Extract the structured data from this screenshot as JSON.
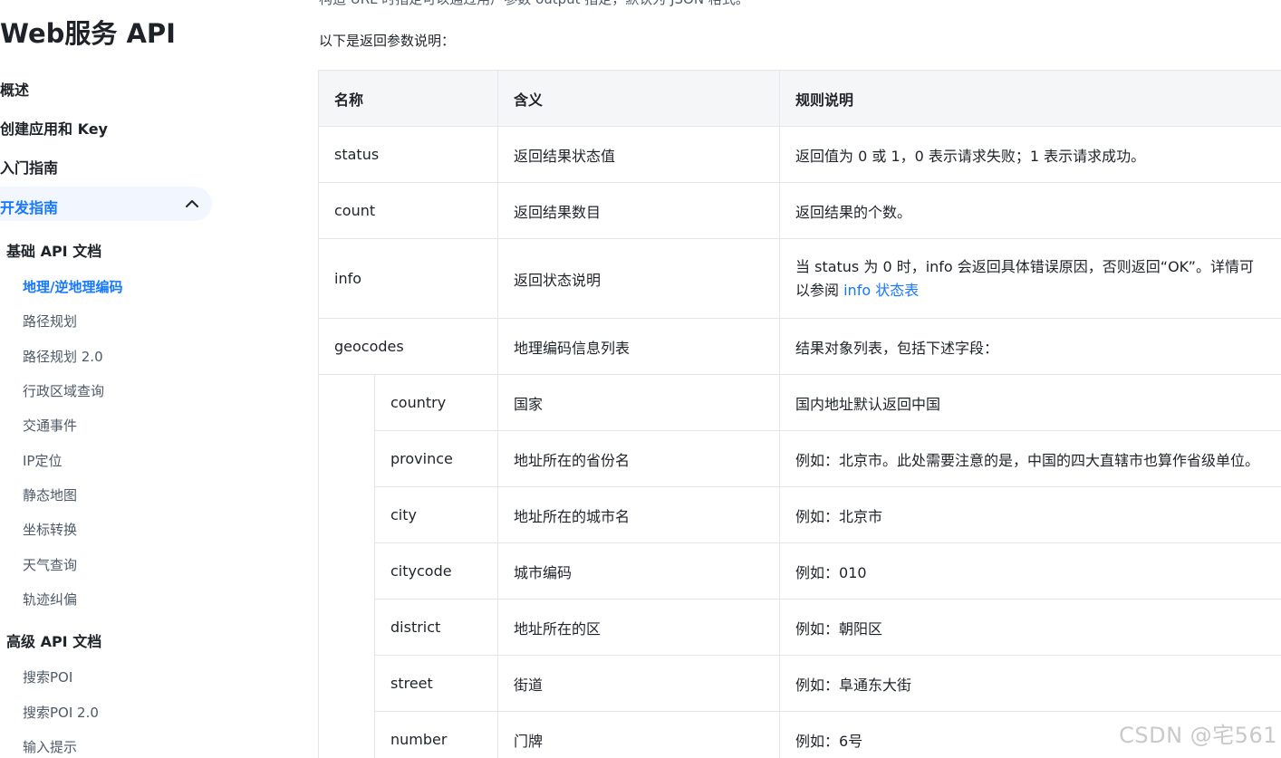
{
  "sidebar": {
    "title": "Web服务 API",
    "top_items": [
      {
        "label": "概述"
      },
      {
        "label": "创建应用和 Key"
      },
      {
        "label": "入门指南"
      }
    ],
    "active_section": "开发指南",
    "groups": [
      {
        "title": "基础 API 文档",
        "items": [
          "地理/逆地理编码",
          "路径规划",
          "路径规划 2.0",
          "行政区域查询",
          "交通事件",
          "IP定位",
          "静态地图",
          "坐标转换",
          "天气查询",
          "轨迹纠偏"
        ]
      },
      {
        "title": "高级 API 文档",
        "items": [
          "搜索POI",
          "搜索POI 2.0",
          "输入提示"
        ]
      }
    ],
    "active_item": "地理/逆地理编码"
  },
  "main": {
    "top_cut_text": "构造 URL 时指定可以通过用户参数 output 指定，默认为 JSON 格式。",
    "intro": "以下是返回参数说明：",
    "table": {
      "headers": [
        "名称",
        "含义",
        "规则说明"
      ],
      "rows": [
        {
          "name": "status",
          "meaning": "返回结果状态值",
          "rule": "返回值为 0 或 1，0 表示请求失败；1 表示请求成功。"
        },
        {
          "name": "count",
          "meaning": "返回结果数目",
          "rule": "返回结果的个数。"
        },
        {
          "name": "info",
          "meaning": "返回状态说明",
          "rule": "当 status 为 0 时，info 会返回具体错误原因，否则返回“OK”。详情可",
          "rule_line2_prefix": "以参阅 ",
          "rule_link": "info 状态表"
        },
        {
          "name": "geocodes",
          "meaning": "地理编码信息列表",
          "rule": "结果对象列表，包括下述字段："
        }
      ],
      "sub_rows": [
        {
          "name": "country",
          "meaning": "国家",
          "rule": "国内地址默认返回中国"
        },
        {
          "name": "province",
          "meaning": "地址所在的省份名",
          "rule": "例如：北京市。此处需要注意的是，中国的四大直辖市也算作省级单位。"
        },
        {
          "name": "city",
          "meaning": "地址所在的城市名",
          "rule": "例如：北京市"
        },
        {
          "name": "citycode",
          "meaning": "城市编码",
          "rule": "例如：010"
        },
        {
          "name": "district",
          "meaning": "地址所在的区",
          "rule": "例如：朝阳区"
        },
        {
          "name": "street",
          "meaning": "街道",
          "rule": "例如：阜通东大街"
        },
        {
          "name": "number",
          "meaning": "门牌",
          "rule": "例如：6号"
        }
      ]
    }
  },
  "watermark": "CSDN @宅561",
  "colors": {
    "accent": "#1677ff",
    "active_bg": "#f2f6ff",
    "header_bg": "#f5f6f7",
    "border": "#e5e6eb"
  }
}
